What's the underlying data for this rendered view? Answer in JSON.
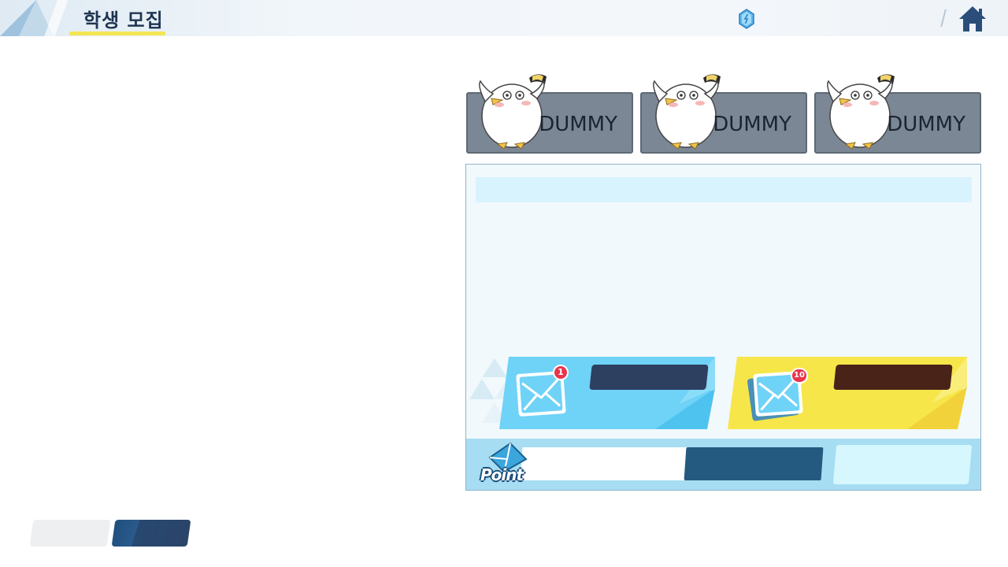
{
  "header": {
    "title": "학생 모집",
    "gem_icon": "gem-icon",
    "home_icon": "home-icon"
  },
  "banners": [
    {
      "label": "DUMMY",
      "image": "dummy-bird"
    },
    {
      "label": "DUMMY",
      "image": "dummy-bird"
    },
    {
      "label": "DUMMY",
      "image": "dummy-bird"
    }
  ],
  "recruit": {
    "single": {
      "badge": "1",
      "icon": "mail-icon"
    },
    "multi": {
      "badge": "10",
      "icon": "mail-stack-icon"
    }
  },
  "point": {
    "label": "Point",
    "icon": "point-mail-icon"
  },
  "colors": {
    "accent_blue": "#6fd2f7",
    "accent_yellow": "#f6e64a",
    "point_fill": "#245a80",
    "title_underline": "#f3e653"
  }
}
